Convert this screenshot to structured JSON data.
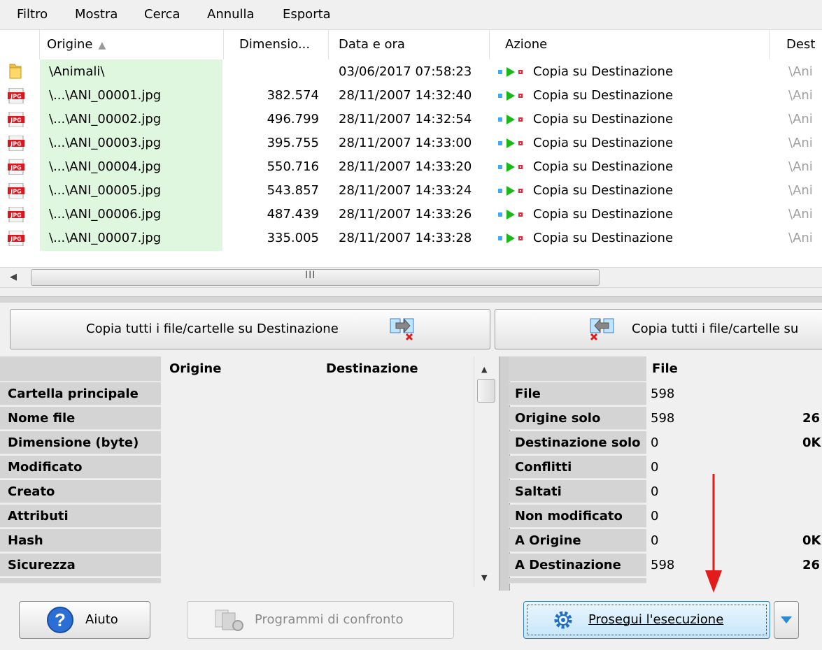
{
  "menu": {
    "items": [
      "Filtro",
      "Mostra",
      "Cerca",
      "Annulla",
      "Esporta"
    ]
  },
  "file_list": {
    "columns": {
      "origin": "Origine",
      "size": "Dimensio...",
      "date": "Data e ora",
      "action": "Azione",
      "dest": "Dest"
    },
    "rows": [
      {
        "icon": "folder-icon",
        "origin": "\\Animali\\",
        "size": "",
        "date": "03/06/2017 07:58:23",
        "action": "Copia su Destinazione",
        "dest": "\\Ani"
      },
      {
        "icon": "jpg-file-icon",
        "origin": "\\...\\ANI_00001.jpg",
        "size": "382.574",
        "date": "28/11/2007 14:32:40",
        "action": "Copia su Destinazione",
        "dest": "\\Ani"
      },
      {
        "icon": "jpg-file-icon",
        "origin": "\\...\\ANI_00002.jpg",
        "size": "496.799",
        "date": "28/11/2007 14:32:54",
        "action": "Copia su Destinazione",
        "dest": "\\Ani"
      },
      {
        "icon": "jpg-file-icon",
        "origin": "\\...\\ANI_00003.jpg",
        "size": "395.755",
        "date": "28/11/2007 14:33:00",
        "action": "Copia su Destinazione",
        "dest": "\\Ani"
      },
      {
        "icon": "jpg-file-icon",
        "origin": "\\...\\ANI_00004.jpg",
        "size": "550.716",
        "date": "28/11/2007 14:33:20",
        "action": "Copia su Destinazione",
        "dest": "\\Ani"
      },
      {
        "icon": "jpg-file-icon",
        "origin": "\\...\\ANI_00005.jpg",
        "size": "543.857",
        "date": "28/11/2007 14:33:24",
        "action": "Copia su Destinazione",
        "dest": "\\Ani"
      },
      {
        "icon": "jpg-file-icon",
        "origin": "\\...\\ANI_00006.jpg",
        "size": "487.439",
        "date": "28/11/2007 14:33:26",
        "action": "Copia su Destinazione",
        "dest": "\\Ani"
      },
      {
        "icon": "jpg-file-icon",
        "origin": "\\...\\ANI_00007.jpg",
        "size": "335.005",
        "date": "28/11/2007 14:33:28",
        "action": "Copia su Destinazione",
        "dest": "\\Ani"
      }
    ]
  },
  "scrollbar": {
    "grip": "III",
    "left_arrow": "◀"
  },
  "copy_buttons": {
    "to_dest": "Copia tutti i file/cartelle su Destinazione",
    "to_origin": "Copia tutti i file/cartelle su"
  },
  "properties": {
    "head_origin": "Origine",
    "head_dest": "Destinazione",
    "rows": [
      "Cartella principale",
      "Nome file",
      "Dimensione (byte)",
      "Modificato",
      "Creato",
      "Attributi",
      "Hash",
      "Sicurezza"
    ]
  },
  "stats": {
    "head": "File",
    "rows": [
      {
        "label": "File",
        "value": "598",
        "extra": ""
      },
      {
        "label": "Origine solo",
        "value": "598",
        "extra": "26"
      },
      {
        "label": "Destinazione solo",
        "value": "0",
        "extra": "0K"
      },
      {
        "label": "Conflitti",
        "value": "0",
        "extra": ""
      },
      {
        "label": "Saltati",
        "value": "0",
        "extra": ""
      },
      {
        "label": "Non modificato",
        "value": "0",
        "extra": ""
      },
      {
        "label": "A Origine",
        "value": "0",
        "extra": "0K"
      },
      {
        "label": "A Destinazione",
        "value": "598",
        "extra": "26"
      }
    ]
  },
  "buttons": {
    "help": "Aiuto",
    "compare": "Programmi di confronto",
    "continue": "Prosegui l'esecuzione"
  },
  "colors": {
    "origin_highlight": "#dff7df",
    "action_green": "#18b918",
    "action_square_blue": "#3fa9f5",
    "action_square_red": "#e8263a",
    "jpg_red": "#d8181f",
    "annotation_red": "#e31b1b",
    "continue_blue": "#c6e6fb"
  }
}
